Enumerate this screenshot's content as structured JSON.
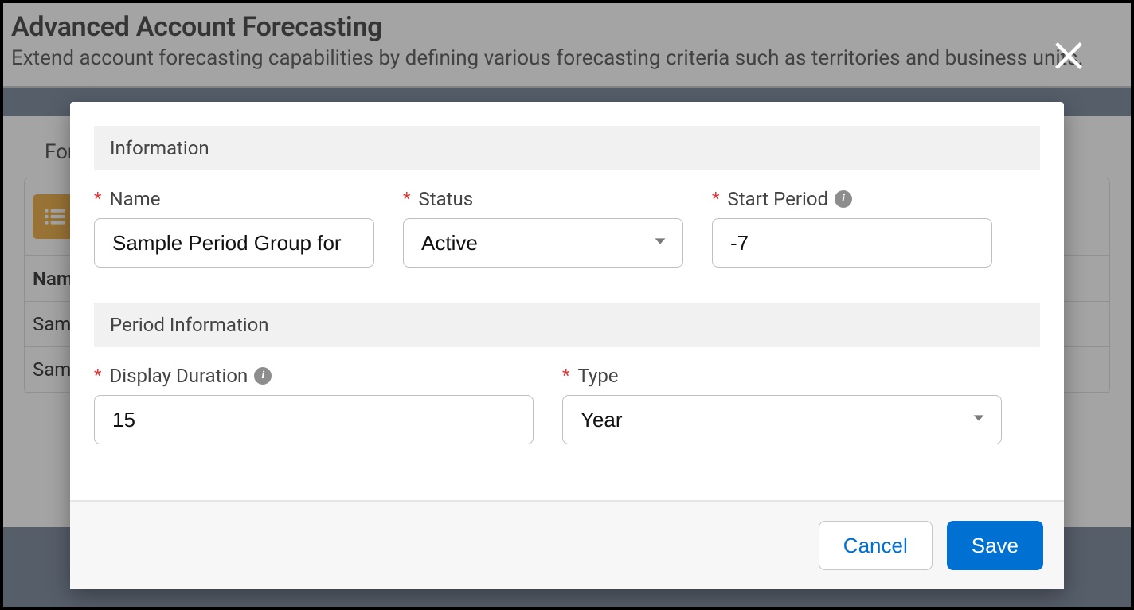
{
  "page": {
    "title": "Advanced Account Forecasting",
    "subtitle": "Extend account forecasting capabilities by defining various forecasting criteria such as territories and business units.",
    "tab_partial": "Fore",
    "column_header_partial": "Nam",
    "rows": [
      {
        "cell_partial": "Sam"
      },
      {
        "cell_partial": "Sam"
      }
    ]
  },
  "modal": {
    "sections": {
      "info": {
        "header": "Information",
        "name_label": "Name",
        "name_value": "Sample Period Group for",
        "status_label": "Status",
        "status_value": "Active",
        "start_label": "Start Period",
        "start_value": "-7"
      },
      "period": {
        "header": "Period Information",
        "duration_label": "Display Duration",
        "duration_value": "15",
        "type_label": "Type",
        "type_value": "Year"
      }
    },
    "cancel_label": "Cancel",
    "save_label": "Save"
  }
}
